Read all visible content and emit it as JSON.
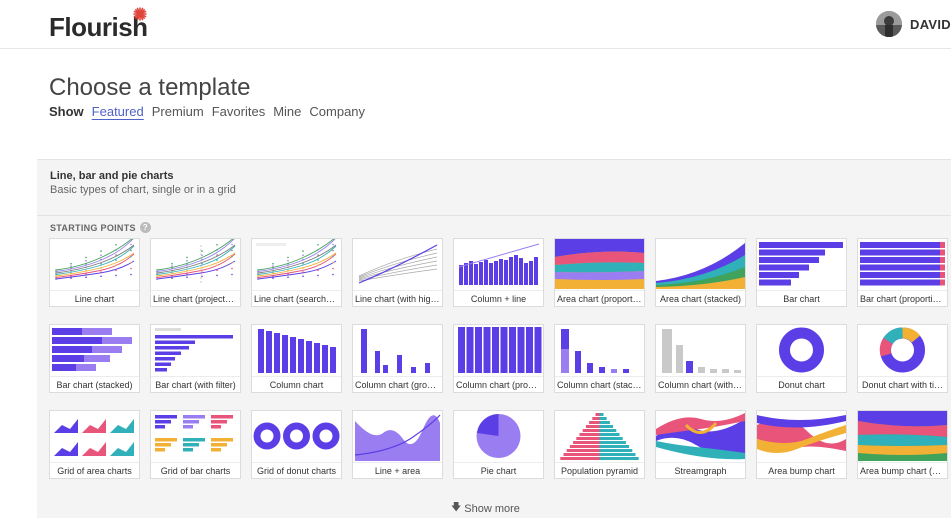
{
  "brand": {
    "name": "Flourish",
    "star_color": "#e0453b"
  },
  "user": {
    "name": "DAVID"
  },
  "page": {
    "title": "Choose a template"
  },
  "filters": {
    "show_label": "Show",
    "tabs": [
      "Featured",
      "Premium",
      "Favorites",
      "Mine",
      "Company"
    ],
    "active": "Featured"
  },
  "category": {
    "title": "Line, bar and pie charts",
    "description": "Basic types of chart, single or in a grid",
    "starting_points_label": "STARTING POINTS",
    "help_glyph": "?"
  },
  "templates": [
    {
      "label": "Line chart",
      "thumb": "line"
    },
    {
      "label": "Line chart (projected)",
      "thumb": "line-proj"
    },
    {
      "label": "Line chart (searchable)",
      "thumb": "line-search"
    },
    {
      "label": "Line chart (with high…",
      "thumb": "line-high"
    },
    {
      "label": "Column + line",
      "thumb": "col-line"
    },
    {
      "label": "Area chart (proporti…",
      "thumb": "area-prop"
    },
    {
      "label": "Area chart (stacked)",
      "thumb": "area-stack"
    },
    {
      "label": "Bar chart",
      "thumb": "bar"
    },
    {
      "label": "Bar chart (proportio…",
      "thumb": "bar-prop"
    },
    {
      "label": "Bar chart (stacked)",
      "thumb": "bar-stack"
    },
    {
      "label": "Bar chart (with filter)",
      "thumb": "bar-filter"
    },
    {
      "label": "Column chart",
      "thumb": "column"
    },
    {
      "label": "Column chart (grou…",
      "thumb": "col-group"
    },
    {
      "label": "Column chart (prop…",
      "thumb": "col-prop"
    },
    {
      "label": "Column chart (stack…",
      "thumb": "col-stack"
    },
    {
      "label": "Column chart (with …",
      "thumb": "col-with"
    },
    {
      "label": "Donut chart",
      "thumb": "donut"
    },
    {
      "label": "Donut chart with ti…",
      "thumb": "donut-ti"
    },
    {
      "label": "Grid of area charts",
      "thumb": "grid-area"
    },
    {
      "label": "Grid of bar charts",
      "thumb": "grid-bar"
    },
    {
      "label": "Grid of donut charts",
      "thumb": "grid-donut"
    },
    {
      "label": "Line + area",
      "thumb": "line-area"
    },
    {
      "label": "Pie chart",
      "thumb": "pie"
    },
    {
      "label": "Population pyramid",
      "thumb": "pyramid"
    },
    {
      "label": "Streamgraph",
      "thumb": "stream"
    },
    {
      "label": "Area bump chart",
      "thumb": "bump"
    },
    {
      "label": "Area bump chart (pr…",
      "thumb": "bump-pr"
    }
  ],
  "show_more": {
    "label": "Show more",
    "icon": "arrow-down-icon"
  },
  "colors": {
    "accent": "#4e61c7",
    "primary_purple": "#5b3ee6",
    "light_purple": "#9a7df0"
  }
}
